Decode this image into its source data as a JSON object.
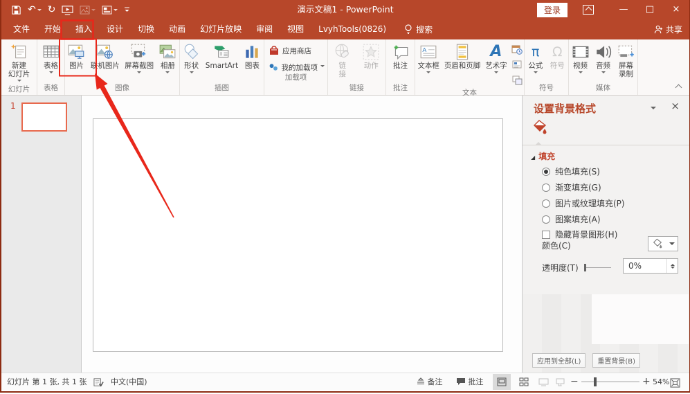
{
  "titlebar": {
    "title": "演示文稿1 - PowerPoint",
    "login": "登录",
    "share": "共享",
    "search": "搜索"
  },
  "glyphs": {
    "undo": "↶",
    "redo": "↻",
    "minimize": "—",
    "maximize": "□",
    "close": "×",
    "fill_marker": "◢",
    "equation": "π",
    "symbol": "Ω",
    "wordart": "A"
  },
  "tabs": [
    {
      "label": "文件"
    },
    {
      "label": "开始"
    },
    {
      "label": "插入",
      "selected": true
    },
    {
      "label": "设计"
    },
    {
      "label": "切换"
    },
    {
      "label": "动画"
    },
    {
      "label": "幻灯片放映"
    },
    {
      "label": "审阅"
    },
    {
      "label": "视图"
    },
    {
      "label": "LvyhTools(0826)"
    }
  ],
  "ribbon": {
    "groups": [
      {
        "caption": "幻灯片",
        "buttons": [
          {
            "label": "新建",
            "label2": "幻灯片",
            "dropdown": true
          }
        ]
      },
      {
        "caption": "表格",
        "buttons": [
          {
            "label": "表格",
            "dropdown": true
          }
        ]
      },
      {
        "caption": "图像",
        "buttons": [
          {
            "label": "图片"
          },
          {
            "label": "联机图片"
          },
          {
            "label": "屏幕截图",
            "dropdown": true
          },
          {
            "label": "相册",
            "dropdown": true
          }
        ]
      },
      {
        "caption": "插图",
        "buttons": [
          {
            "label": "形状",
            "dropdown": true
          },
          {
            "label": "SmartArt"
          },
          {
            "label": "图表"
          }
        ]
      },
      {
        "caption": "加载项",
        "buttons": [
          {
            "label": "应用商店"
          },
          {
            "label": "我的加载项",
            "dropdown": true
          }
        ]
      },
      {
        "caption": "链接",
        "buttons": [
          {
            "label": "链",
            "label2": "接",
            "disabled": true
          },
          {
            "label": "动作",
            "disabled": true
          }
        ]
      },
      {
        "caption": "批注",
        "buttons": [
          {
            "label": "批注"
          }
        ]
      },
      {
        "caption": "文本",
        "buttons": [
          {
            "label": "文本框",
            "dropdown": true
          },
          {
            "label": "页眉和页脚"
          },
          {
            "label": "艺术字",
            "dropdown": true
          }
        ]
      },
      {
        "caption": "符号",
        "buttons": [
          {
            "label": "公式",
            "dropdown": true
          },
          {
            "label": "符号",
            "disabled": true
          }
        ]
      },
      {
        "caption": "媒体",
        "buttons": [
          {
            "label": "视频",
            "dropdown": true
          },
          {
            "label": "音频",
            "dropdown": true
          },
          {
            "label": "屏幕",
            "label2": "录制"
          }
        ]
      }
    ]
  },
  "thumbnail_panel": {
    "slide_number": "1"
  },
  "format_panel": {
    "title": "设置背景格式",
    "section_fill": "填充",
    "radio_solid": "纯色填充(S)",
    "radio_gradient": "渐变填充(G)",
    "radio_picture": "图片或纹理填充(P)",
    "radio_pattern": "图案填充(A)",
    "checkbox_hide": "隐藏背景图形(H)",
    "color_label": "颜色(C)",
    "transparency_label": "透明度(T)",
    "transparency_value": "0%",
    "apply_all": "应用到全部(L)",
    "reset_bg": "重置背景(B)"
  },
  "statusbar": {
    "slide_info": "幻灯片 第 1 张, 共 1 张",
    "language": "中文(中国)",
    "notes": "备注",
    "comments": "批注",
    "zoom_percent": "54%"
  }
}
